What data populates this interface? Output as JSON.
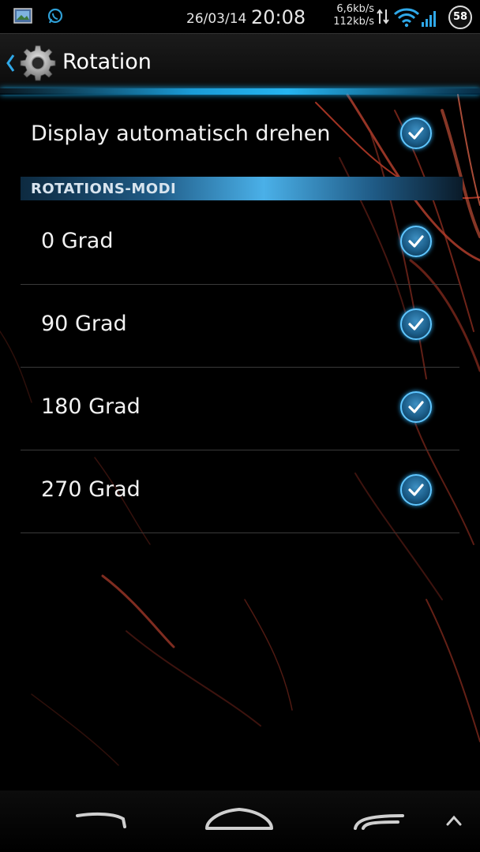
{
  "status_bar": {
    "date": "26/03/14",
    "time": "20:08",
    "upload_speed": "6,6kb/s",
    "download_speed": "112kb/s",
    "battery": "58"
  },
  "action_bar": {
    "title": "Rotation"
  },
  "settings": {
    "auto_rotate": {
      "label": "Display automatisch drehen",
      "checked": true
    },
    "section_header": "ROTATIONS-MODI",
    "modes": [
      {
        "label": "0 Grad",
        "checked": true
      },
      {
        "label": "90 Grad",
        "checked": true
      },
      {
        "label": "180 Grad",
        "checked": true
      },
      {
        "label": "270 Grad",
        "checked": true
      }
    ]
  },
  "colors": {
    "accent": "#25b4f0",
    "background": "#000000",
    "streak": "#c8402c"
  },
  "icons": {
    "status_left": [
      "gallery-icon",
      "whatsapp-icon"
    ],
    "navigation": [
      "back-icon",
      "home-icon",
      "recent-apps-icon",
      "menu-up-icon"
    ]
  }
}
